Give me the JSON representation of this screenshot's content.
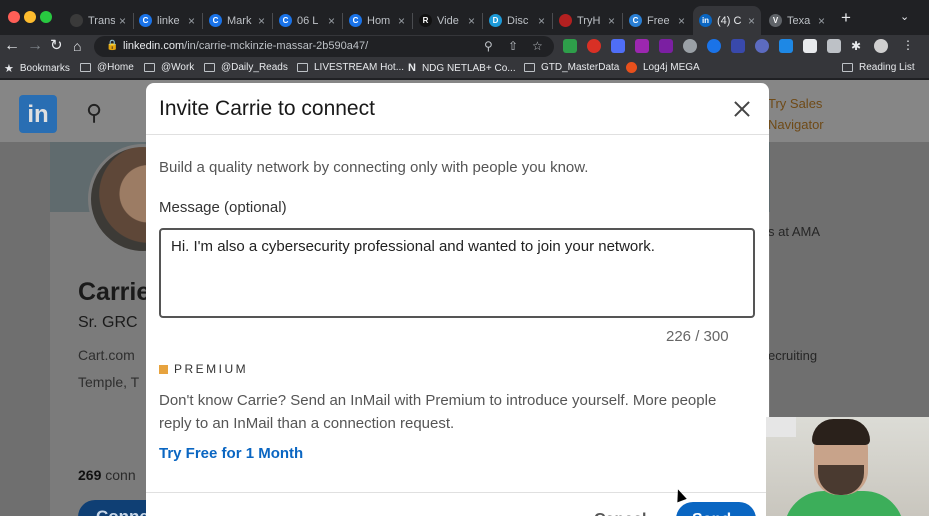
{
  "browser": {
    "tabs": [
      {
        "title": "Trans",
        "fav_color": "#3a3a3a",
        "fav_char": ""
      },
      {
        "title": "linke",
        "fav_color": "#1a73e8",
        "fav_char": "C"
      },
      {
        "title": "Mark",
        "fav_color": "#1a73e8",
        "fav_char": "C"
      },
      {
        "title": "06 L",
        "fav_color": "#1a73e8",
        "fav_char": "C"
      },
      {
        "title": "Hom",
        "fav_color": "#1a73e8",
        "fav_char": "C"
      },
      {
        "title": "Vide",
        "fav_color": "#111111",
        "fav_char": "R"
      },
      {
        "title": "Disc",
        "fav_color": "#1d9ad8",
        "fav_char": "D"
      },
      {
        "title": "TryH",
        "fav_color": "#b32020",
        "fav_char": ""
      },
      {
        "title": "Free",
        "fav_color": "#2a7fd4",
        "fav_char": "C"
      },
      {
        "title": "(4) C",
        "fav_color": "#0a66c2",
        "fav_char": "in"
      },
      {
        "title": "Texa",
        "fav_color": "#5f6368",
        "fav_char": "V"
      }
    ],
    "new_tab_icon": "plus-icon",
    "url_host": "linkedin.com",
    "url_path": "/in/carrie-mckinzie-massar-2b590a47/",
    "bookmarks": [
      {
        "label": "Bookmarks",
        "icon": "star-icon"
      },
      {
        "label": "@Home",
        "icon": "folder-icon"
      },
      {
        "label": "@Work",
        "icon": "folder-icon"
      },
      {
        "label": "@Daily_Reads",
        "icon": "folder-icon"
      },
      {
        "label": "LIVESTREAM Hot...",
        "icon": "folder-icon"
      },
      {
        "label": "NDG NETLAB+ Co...",
        "icon": "netlab-icon"
      },
      {
        "label": "GTD_MasterData",
        "icon": "folder-icon"
      },
      {
        "label": "Log4j MEGA",
        "icon": "log4j-icon"
      },
      {
        "label": "Reading List",
        "icon": "reading-list-icon"
      }
    ]
  },
  "linkedin": {
    "logo": "in",
    "sales_line1": "Try Sales",
    "sales_line2": "Navigator",
    "profile": {
      "name": "Carrie",
      "title": "Sr. GRC",
      "company": "Cart.com",
      "location": "Temple, T",
      "connections_count": "269",
      "connections_label": " conn",
      "connect_btn": "Conne"
    },
    "right_text_1": "s at AMA",
    "right_text_2": "ecruiting"
  },
  "modal": {
    "title": "Invite Carrie to connect",
    "intro": "Build a quality network by connecting only with people you know.",
    "message_label": "Message (optional)",
    "message_value": "Hi. I'm also a cybersecurity professional and wanted to join your network.",
    "counter": "226 / 300",
    "premium_label": "PREMIUM",
    "premium_desc": "Don't know Carrie? Send an InMail with Premium to introduce yourself. More people reply to an InMail than a connection request.",
    "try_free": "Try Free for 1 Month",
    "cancel": "Cancel",
    "send": "Send"
  }
}
